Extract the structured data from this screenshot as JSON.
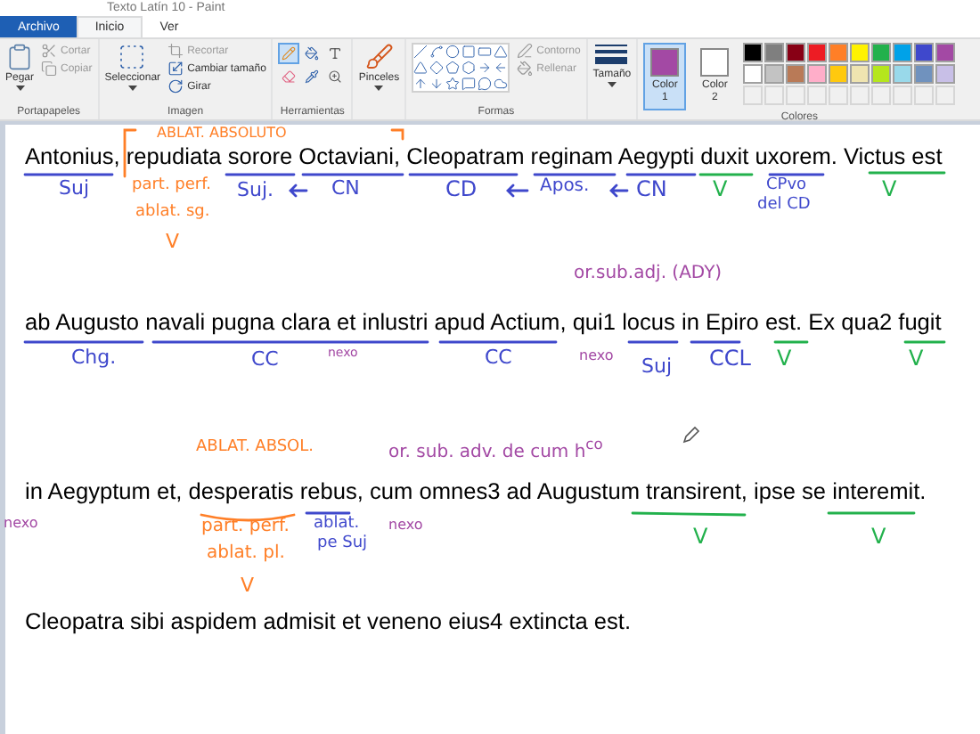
{
  "window": {
    "title": "Texto Latín 10 - Paint"
  },
  "tabs": [
    {
      "label": "Archivo",
      "kind": "file",
      "selected": false
    },
    {
      "label": "Inicio",
      "kind": "tab",
      "selected": true
    },
    {
      "label": "Ver",
      "kind": "tab",
      "selected": false
    }
  ],
  "ribbon": {
    "clipboard": {
      "label": "Portapapeles",
      "paste": "Pegar",
      "items": [
        {
          "label": "Cortar",
          "disabled": true
        },
        {
          "label": "Copiar",
          "disabled": true
        }
      ]
    },
    "image": {
      "label": "Imagen",
      "select": "Seleccionar",
      "items": [
        {
          "label": "Recortar",
          "disabled": true
        },
        {
          "label": "Cambiar tamaño",
          "disabled": false
        },
        {
          "label": "Girar",
          "disabled": false
        }
      ]
    },
    "tools": {
      "label": "Herramientas"
    },
    "brushes": {
      "label": "Pinceles"
    },
    "shapes": {
      "label": "Formas",
      "items": [
        {
          "label": "Contorno",
          "disabled": true
        },
        {
          "label": "Rellenar",
          "disabled": true
        }
      ]
    },
    "size": {
      "label": "Tamaño"
    },
    "colors": {
      "label": "Colores",
      "slots": [
        {
          "label": "Color",
          "number": "1",
          "color": "#a349a4",
          "selected": true
        },
        {
          "label": "Color",
          "number": "2",
          "color": "#ffffff",
          "selected": false
        }
      ],
      "palette": [
        {
          "color": "#000000"
        },
        {
          "color": "#7f7f7f"
        },
        {
          "color": "#880015"
        },
        {
          "color": "#ed1c24"
        },
        {
          "color": "#ff7f27"
        },
        {
          "color": "#fff200"
        },
        {
          "color": "#22b14c"
        },
        {
          "color": "#00a2e8"
        },
        {
          "color": "#3f48cc"
        },
        {
          "color": "#a349a4"
        },
        {
          "color": "#ffffff"
        },
        {
          "color": "#c3c3c3"
        },
        {
          "color": "#b97a57"
        },
        {
          "color": "#ffaec9"
        },
        {
          "color": "#ffc90e"
        },
        {
          "color": "#efe4b0"
        },
        {
          "color": "#b5e61d"
        },
        {
          "color": "#99d9ea"
        },
        {
          "color": "#7092be"
        },
        {
          "color": "#c8bfe7"
        }
      ]
    }
  },
  "canvas": {
    "lines": [
      "Antonius, repudiata sorore Octaviani, Cleopatram reginam Aegypti duxit uxorem. Victus est",
      "ab Augusto navali pugna clara et inlustri apud Actium, qui1 locus in Epiro est. Ex qua2 fugit",
      "in Aegyptum et, desperatis rebus, cum omnes3 ad Augustum transirent, ipse se interemit.",
      "Cleopatra sibi aspidem admisit et veneno eius4 extincta est."
    ],
    "annotations": [
      {
        "text": "ABLAT. ABSOLUTO",
        "color": "#ff7f27"
      },
      {
        "text": "Suj",
        "color": "#3f48cc"
      },
      {
        "text": "part. perf.",
        "color": "#ff7f27"
      },
      {
        "text": "Suj.",
        "color": "#3f48cc"
      },
      {
        "text": "CN",
        "color": "#3f48cc"
      },
      {
        "text": "CD",
        "color": "#3f48cc"
      },
      {
        "text": "Apos.",
        "color": "#3f48cc"
      },
      {
        "text": "CN",
        "color": "#3f48cc"
      },
      {
        "text": "V",
        "color": "#22b14c"
      },
      {
        "text": "CPvo",
        "color": "#3f48cc"
      },
      {
        "text": "del CD",
        "color": "#3f48cc"
      },
      {
        "text": "V",
        "color": "#22b14c"
      },
      {
        "text": "ablat. sg.",
        "color": "#ff7f27"
      },
      {
        "text": "V",
        "color": "#ff7f27"
      },
      {
        "text": "or.sub.adj. (ADY)",
        "color": "#a349a4"
      },
      {
        "text": "Chg.",
        "color": "#3f48cc"
      },
      {
        "text": "CC",
        "color": "#3f48cc"
      },
      {
        "text": "nexo",
        "color": "#a349a4"
      },
      {
        "text": "CC",
        "color": "#3f48cc"
      },
      {
        "text": "nexo",
        "color": "#a349a4"
      },
      {
        "text": "Suj",
        "color": "#3f48cc"
      },
      {
        "text": "CCL",
        "color": "#3f48cc"
      },
      {
        "text": "V",
        "color": "#22b14c"
      },
      {
        "text": "V",
        "color": "#22b14c"
      },
      {
        "text": "ABLAT. ABSOL.",
        "color": "#ff7f27"
      },
      {
        "text": "or. sub. adv. de cum h$^{co}$",
        "color": "#a349a4"
      },
      {
        "text": "nexo",
        "color": "#a349a4"
      },
      {
        "text": "part. perf.",
        "color": "#ff7f27"
      },
      {
        "text": "ablat.",
        "color": "#3f48cc"
      },
      {
        "text": "pe Suj",
        "color": "#3f48cc"
      },
      {
        "text": "nexo",
        "color": "#a349a4"
      },
      {
        "text": "ablat. pl.",
        "color": "#ff7f27"
      },
      {
        "text": "V",
        "color": "#ff7f27"
      },
      {
        "text": "V",
        "color": "#22b14c"
      },
      {
        "text": "V",
        "color": "#22b14c"
      }
    ]
  }
}
